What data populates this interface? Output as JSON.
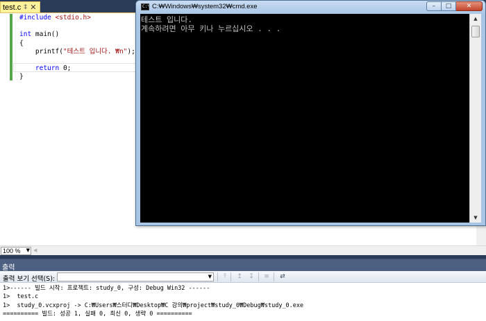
{
  "editor": {
    "tab_label": "test.c",
    "tab_pin": "‡",
    "tab_close": "✕",
    "code_lines": [
      {
        "parts": [
          {
            "t": "#include ",
            "c": "kw"
          },
          {
            "t": "<stdio.h>",
            "c": "inc"
          }
        ]
      },
      {
        "parts": [
          {
            "t": "",
            "c": ""
          }
        ]
      },
      {
        "parts": [
          {
            "t": "int",
            "c": "kw"
          },
          {
            "t": " main()",
            "c": ""
          }
        ]
      },
      {
        "parts": [
          {
            "t": "{",
            "c": ""
          }
        ]
      },
      {
        "parts": [
          {
            "t": "    printf(",
            "c": ""
          },
          {
            "t": "\"테스트 입니다. ₩n\"",
            "c": "str"
          },
          {
            "t": ");",
            "c": ""
          }
        ]
      },
      {
        "parts": [
          {
            "t": "",
            "c": ""
          }
        ]
      },
      {
        "parts": [
          {
            "t": "    ",
            "c": ""
          },
          {
            "t": "return",
            "c": "kw"
          },
          {
            "t": " 0;",
            "c": ""
          }
        ]
      },
      {
        "parts": [
          {
            "t": "}",
            "c": ""
          }
        ]
      }
    ]
  },
  "console": {
    "title": "C:₩Windows₩system32₩cmd.exe",
    "icon_text": "C:\\",
    "min_glyph": "–",
    "max_glyph": "□",
    "close_glyph": "✕",
    "lines": "테스트 입니다.\n계속하려면 아무 키나 누르십시오 . . .",
    "scroll_up": "▲",
    "scroll_down": "▼"
  },
  "zoom": {
    "value": "100 %",
    "arrow": "▼",
    "hscroll_left": "◀"
  },
  "output": {
    "title": "출력",
    "source_label": "출력 보기 선택(S):",
    "source_value": "",
    "source_arrow": "▼",
    "toolbar_icons": [
      {
        "name": "goto-prev-message-icon",
        "glyph": "⤒",
        "active": false
      },
      {
        "name": "goto-next-message-icon",
        "glyph": "↥",
        "active": false
      },
      {
        "name": "find-message-icon",
        "glyph": "↧",
        "active": false
      },
      {
        "name": "clear-all-icon",
        "glyph": "≡",
        "active": false
      },
      {
        "name": "word-wrap-icon",
        "glyph": "⇄",
        "active": true
      }
    ],
    "lines": [
      "1>------ 빌드 시작: 프로젝트: study_0, 구성: Debug Win32 ------",
      "1>  test.c",
      "1>  study_0.vcxproj -> C:₩Users₩스터디₩Desktop₩C 강의₩project₩study_0₩Debug₩study_0.exe",
      "========== 빌드: 성공 1, 실패 0, 최신 0, 생략 0 =========="
    ]
  },
  "colors": {
    "tab_active": "#fff29d",
    "dock_navy": "#2b3c59",
    "change_green": "#57a64a",
    "keyword_blue": "#0000ff",
    "string_red": "#a31515"
  }
}
